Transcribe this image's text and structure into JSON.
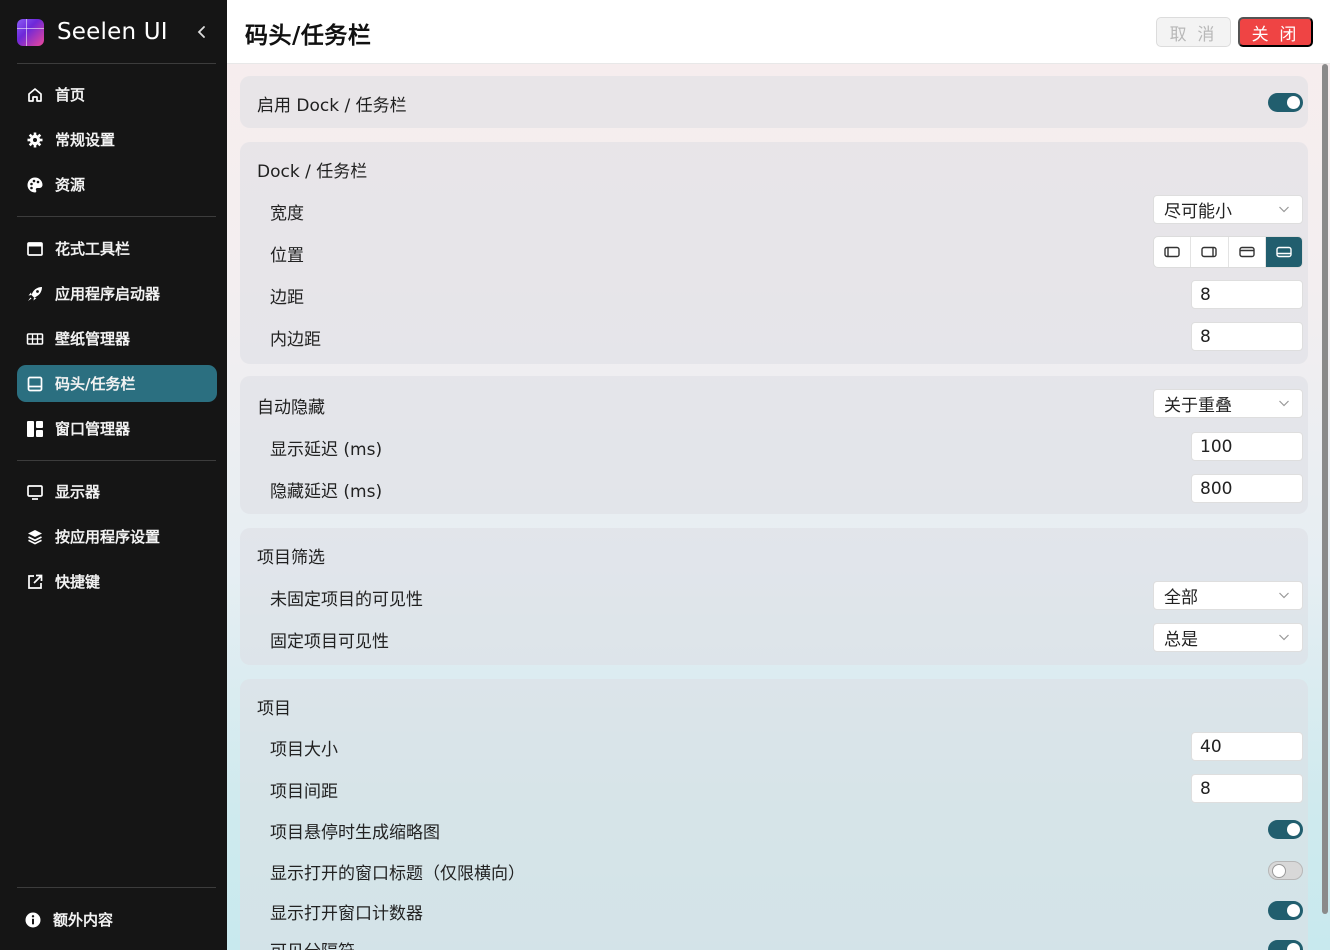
{
  "app": {
    "brand": "Seelen UI"
  },
  "sidebar": {
    "items": [
      {
        "label": "首页",
        "icon": "home-icon"
      },
      {
        "label": "常规设置",
        "icon": "gear-icon"
      },
      {
        "label": "资源",
        "icon": "palette-icon"
      },
      {
        "label": "花式工具栏",
        "icon": "window-icon"
      },
      {
        "label": "应用程序启动器",
        "icon": "rocket-icon"
      },
      {
        "label": "壁纸管理器",
        "icon": "wallpaper-icon"
      },
      {
        "label": "码头/任务栏",
        "icon": "dock-icon",
        "active": true
      },
      {
        "label": "窗口管理器",
        "icon": "layout-icon"
      },
      {
        "label": "显示器",
        "icon": "monitor-icon"
      },
      {
        "label": "按应用程序设置",
        "icon": "layers-icon"
      },
      {
        "label": "快捷键",
        "icon": "external-link-icon"
      }
    ],
    "footer": {
      "label": "额外内容",
      "icon": "info-icon"
    }
  },
  "header": {
    "title": "码头/任务栏",
    "cancel_label": "取 消",
    "close_label": "关 闭"
  },
  "settings": {
    "enable": {
      "label": "启用 Dock / 任务栏",
      "value": true
    },
    "dock": {
      "title": "Dock / 任务栏",
      "width_label": "宽度",
      "width_value": "尽可能小",
      "position_label": "位置",
      "position_options": [
        "left",
        "right",
        "top",
        "bottom"
      ],
      "position_selected": "bottom",
      "margin_label": "边距",
      "margin_value": "8",
      "padding_label": "内边距",
      "padding_value": "8"
    },
    "autohide": {
      "label": "自动隐藏",
      "value": "关于重叠",
      "show_delay_label": "显示延迟 (ms)",
      "show_delay_value": "100",
      "hide_delay_label": "隐藏延迟 (ms)",
      "hide_delay_value": "800"
    },
    "filter": {
      "title": "项目筛选",
      "unpinned_label": "未固定项目的可见性",
      "unpinned_value": "全部",
      "pinned_label": "固定项目可见性",
      "pinned_value": "总是"
    },
    "items": {
      "title": "项目",
      "size_label": "项目大小",
      "size_value": "40",
      "spacing_label": "项目间距",
      "spacing_value": "8",
      "thumbnail_label": "项目悬停时生成缩略图",
      "thumbnail_value": true,
      "window_title_label": "显示打开的窗口标题（仅限横向）",
      "window_title_value": false,
      "counter_label": "显示打开窗口计数器",
      "counter_value": true,
      "separator_label": "可见分隔符",
      "separator_value": true
    }
  },
  "colors": {
    "accent": "#215e6e",
    "active_nav": "#2b6f80",
    "danger": "#ef4444"
  }
}
